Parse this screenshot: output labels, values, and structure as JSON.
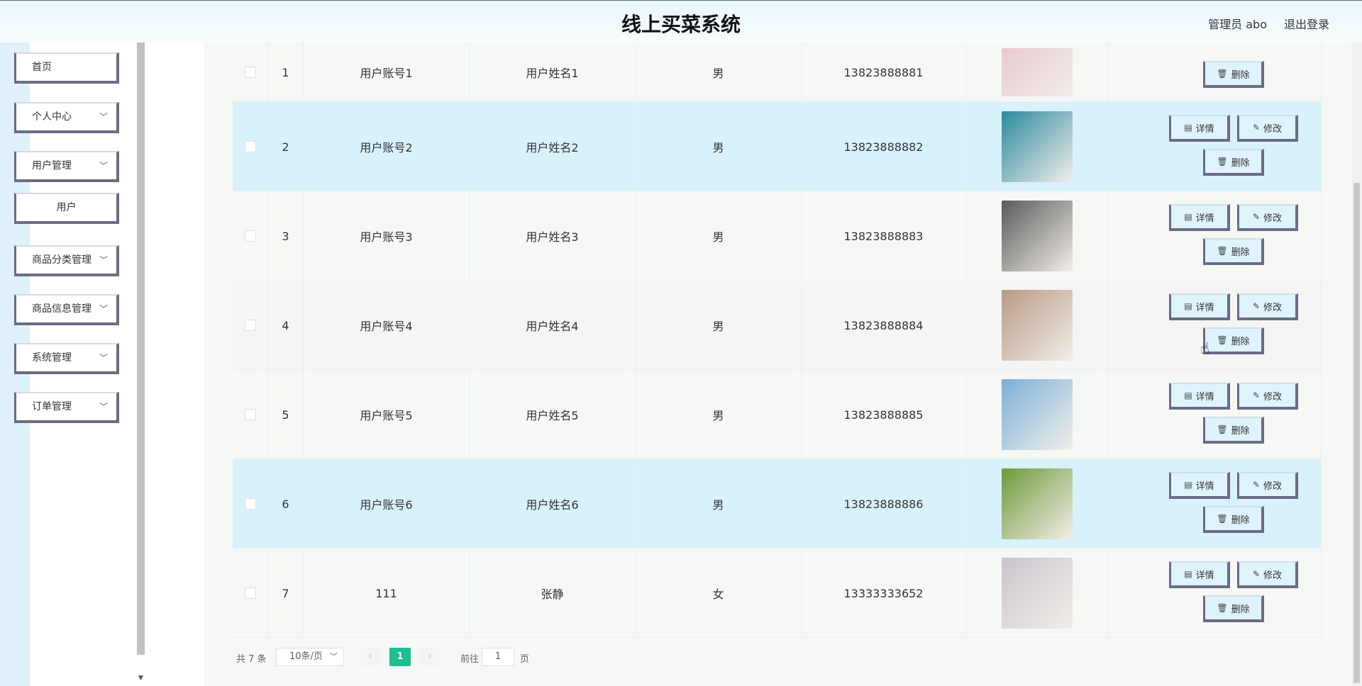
{
  "header": {
    "title": "线上买菜系统",
    "user": "管理员 abo",
    "logout": "退出登录"
  },
  "sidebar": {
    "items": [
      {
        "label": "首页",
        "has_chevron": false
      },
      {
        "label": "个人中心",
        "has_chevron": true
      },
      {
        "label": "用户管理",
        "has_chevron": true
      },
      {
        "label": "用户",
        "submenu": true
      },
      {
        "label": "商品分类管理",
        "has_chevron": true
      },
      {
        "label": "商品信息管理",
        "has_chevron": true
      },
      {
        "label": "系统管理",
        "has_chevron": true
      },
      {
        "label": "订单管理",
        "has_chevron": true
      }
    ]
  },
  "table": {
    "rows": [
      {
        "index": "1",
        "account": "用户账号1",
        "name": "用户姓名1",
        "gender": "男",
        "phone": "13823888881",
        "avatar_color": "#e8c9cf"
      },
      {
        "index": "2",
        "account": "用户账号2",
        "name": "用户姓名2",
        "gender": "男",
        "phone": "13823888882",
        "avatar_color": "#2b8aa0"
      },
      {
        "index": "3",
        "account": "用户账号3",
        "name": "用户姓名3",
        "gender": "男",
        "phone": "13823888883",
        "avatar_color": "#5a5a5a"
      },
      {
        "index": "4",
        "account": "用户账号4",
        "name": "用户姓名4",
        "gender": "男",
        "phone": "13823888884",
        "avatar_color": "#b89a86"
      },
      {
        "index": "5",
        "account": "用户账号5",
        "name": "用户姓名5",
        "gender": "男",
        "phone": "13823888885",
        "avatar_color": "#7ab0d8"
      },
      {
        "index": "6",
        "account": "用户账号6",
        "name": "用户姓名6",
        "gender": "男",
        "phone": "13823888886",
        "avatar_color": "#6d9a3a"
      },
      {
        "index": "7",
        "account": "111",
        "name": "张静",
        "gender": "女",
        "phone": "13333333652",
        "avatar_color": "#c9c4cc"
      }
    ],
    "actions": {
      "detail": "详情",
      "edit": "修改",
      "delete": "删除"
    }
  },
  "pagination": {
    "total": "共 7 条",
    "page_size": "10条/页",
    "current_page": "1",
    "goto_label": "前往",
    "goto_value": "1",
    "page_suffix": "页"
  },
  "colors": {
    "accent": "#1fbf8f",
    "highlight_row": "#d8f2fb"
  }
}
